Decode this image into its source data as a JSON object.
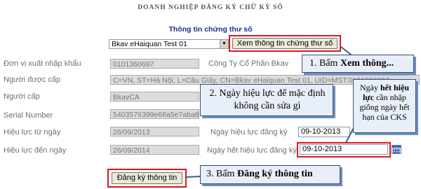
{
  "header": {
    "title": "DOANH NGHIỆP ĐĂNG KÝ CHỮ KÝ SỐ"
  },
  "section": {
    "title": "Thông tin chứng thư số"
  },
  "cert_select": {
    "value": "Bkav eHaiquan Test 01",
    "arrow": "dropdown-arrow-icon"
  },
  "view_cert_button": {
    "label": "Xem thông tin chứng thư số"
  },
  "rows": [
    {
      "label": "Đơn vị xuất nhập khẩu",
      "value": "0101360697",
      "extra_label": "Công Ty Cổ Phần Bkav"
    },
    {
      "label": "Người được cấp",
      "value": "C=VN, ST=Hà Nội, L=Cầu Giấy, CN=Bkav eHaiquan Test 01, UID=MST:0101360697"
    },
    {
      "label": "Người cấp",
      "value": "BkavCA"
    },
    {
      "label": "Serial Number",
      "value": "5403576399e68a5e7aba89"
    },
    {
      "label": "Hiệu lực từ ngày",
      "value": "26/09/2013",
      "right_label": "Ngày hiệu lực đăng ký",
      "right_value": "09-10-2013"
    },
    {
      "label": "Hiệu lực đến ngày",
      "value": "26/09/2014",
      "right_label": "Ngày hết hiệu lực đăng ký",
      "right_value": "09-10-2013"
    }
  ],
  "calendar_icon": "calendar-icon",
  "register_button": {
    "label": "Đăng ký thông tin"
  },
  "callouts": {
    "c1": {
      "num": "1.",
      "text": " Bấm ",
      "bold": "Xem thông..."
    },
    "c2": {
      "num": "2.",
      "text": " Ngày hiệu lực để mặc định không cần sửa gì"
    },
    "c3": {
      "text1": "Ngày ",
      "bold": "hết hiệu lực",
      "text2": " cần nhập giống ngày hết hạn của CKS"
    },
    "c4": {
      "num": "3.",
      "text": " Bấm ",
      "bold": "Đăng ký thông tin"
    }
  },
  "colors": {
    "callout_bg": "#e9eff8",
    "callout_border": "#344f72",
    "highlight": "#e2141d",
    "section_title": "#1f2f8c"
  }
}
